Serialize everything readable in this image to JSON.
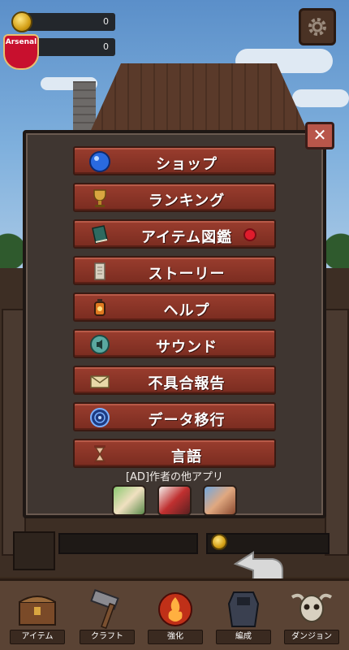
{
  "hud": {
    "gold_count": "0",
    "team_count": "0",
    "team_badge_text": "Arsenal"
  },
  "menu": {
    "items": [
      {
        "label": "ショップ",
        "icon": "blue-orb-icon"
      },
      {
        "label": "ランキング",
        "icon": "trophy-cup-icon"
      },
      {
        "label": "アイテム図鑑",
        "icon": "book-icon",
        "notify": true
      },
      {
        "label": "ストーリー",
        "icon": "scroll-icon"
      },
      {
        "label": "ヘルプ",
        "icon": "lantern-icon"
      },
      {
        "label": "サウンド",
        "icon": "sound-orb-icon"
      },
      {
        "label": "不具合報告",
        "icon": "envelope-icon"
      },
      {
        "label": "データ移行",
        "icon": "magic-circle-icon"
      },
      {
        "label": "言語",
        "icon": "hourglass-icon"
      }
    ],
    "ad_label": "[AD]作者の他アプリ",
    "close_icon": "close-icon"
  },
  "bottom_nav": {
    "items": [
      {
        "label": "アイテム",
        "icon": "chest-icon"
      },
      {
        "label": "クラフト",
        "icon": "hammer-icon"
      },
      {
        "label": "強化",
        "icon": "fire-orb-icon"
      },
      {
        "label": "編成",
        "icon": "armor-icon"
      },
      {
        "label": "ダンジョン",
        "icon": "skull-icon"
      }
    ]
  },
  "colors": {
    "button_red": "#8a3426",
    "panel_bg": "#3f3631",
    "close_red": "#b8564a",
    "notify_red": "#e01c2c"
  }
}
